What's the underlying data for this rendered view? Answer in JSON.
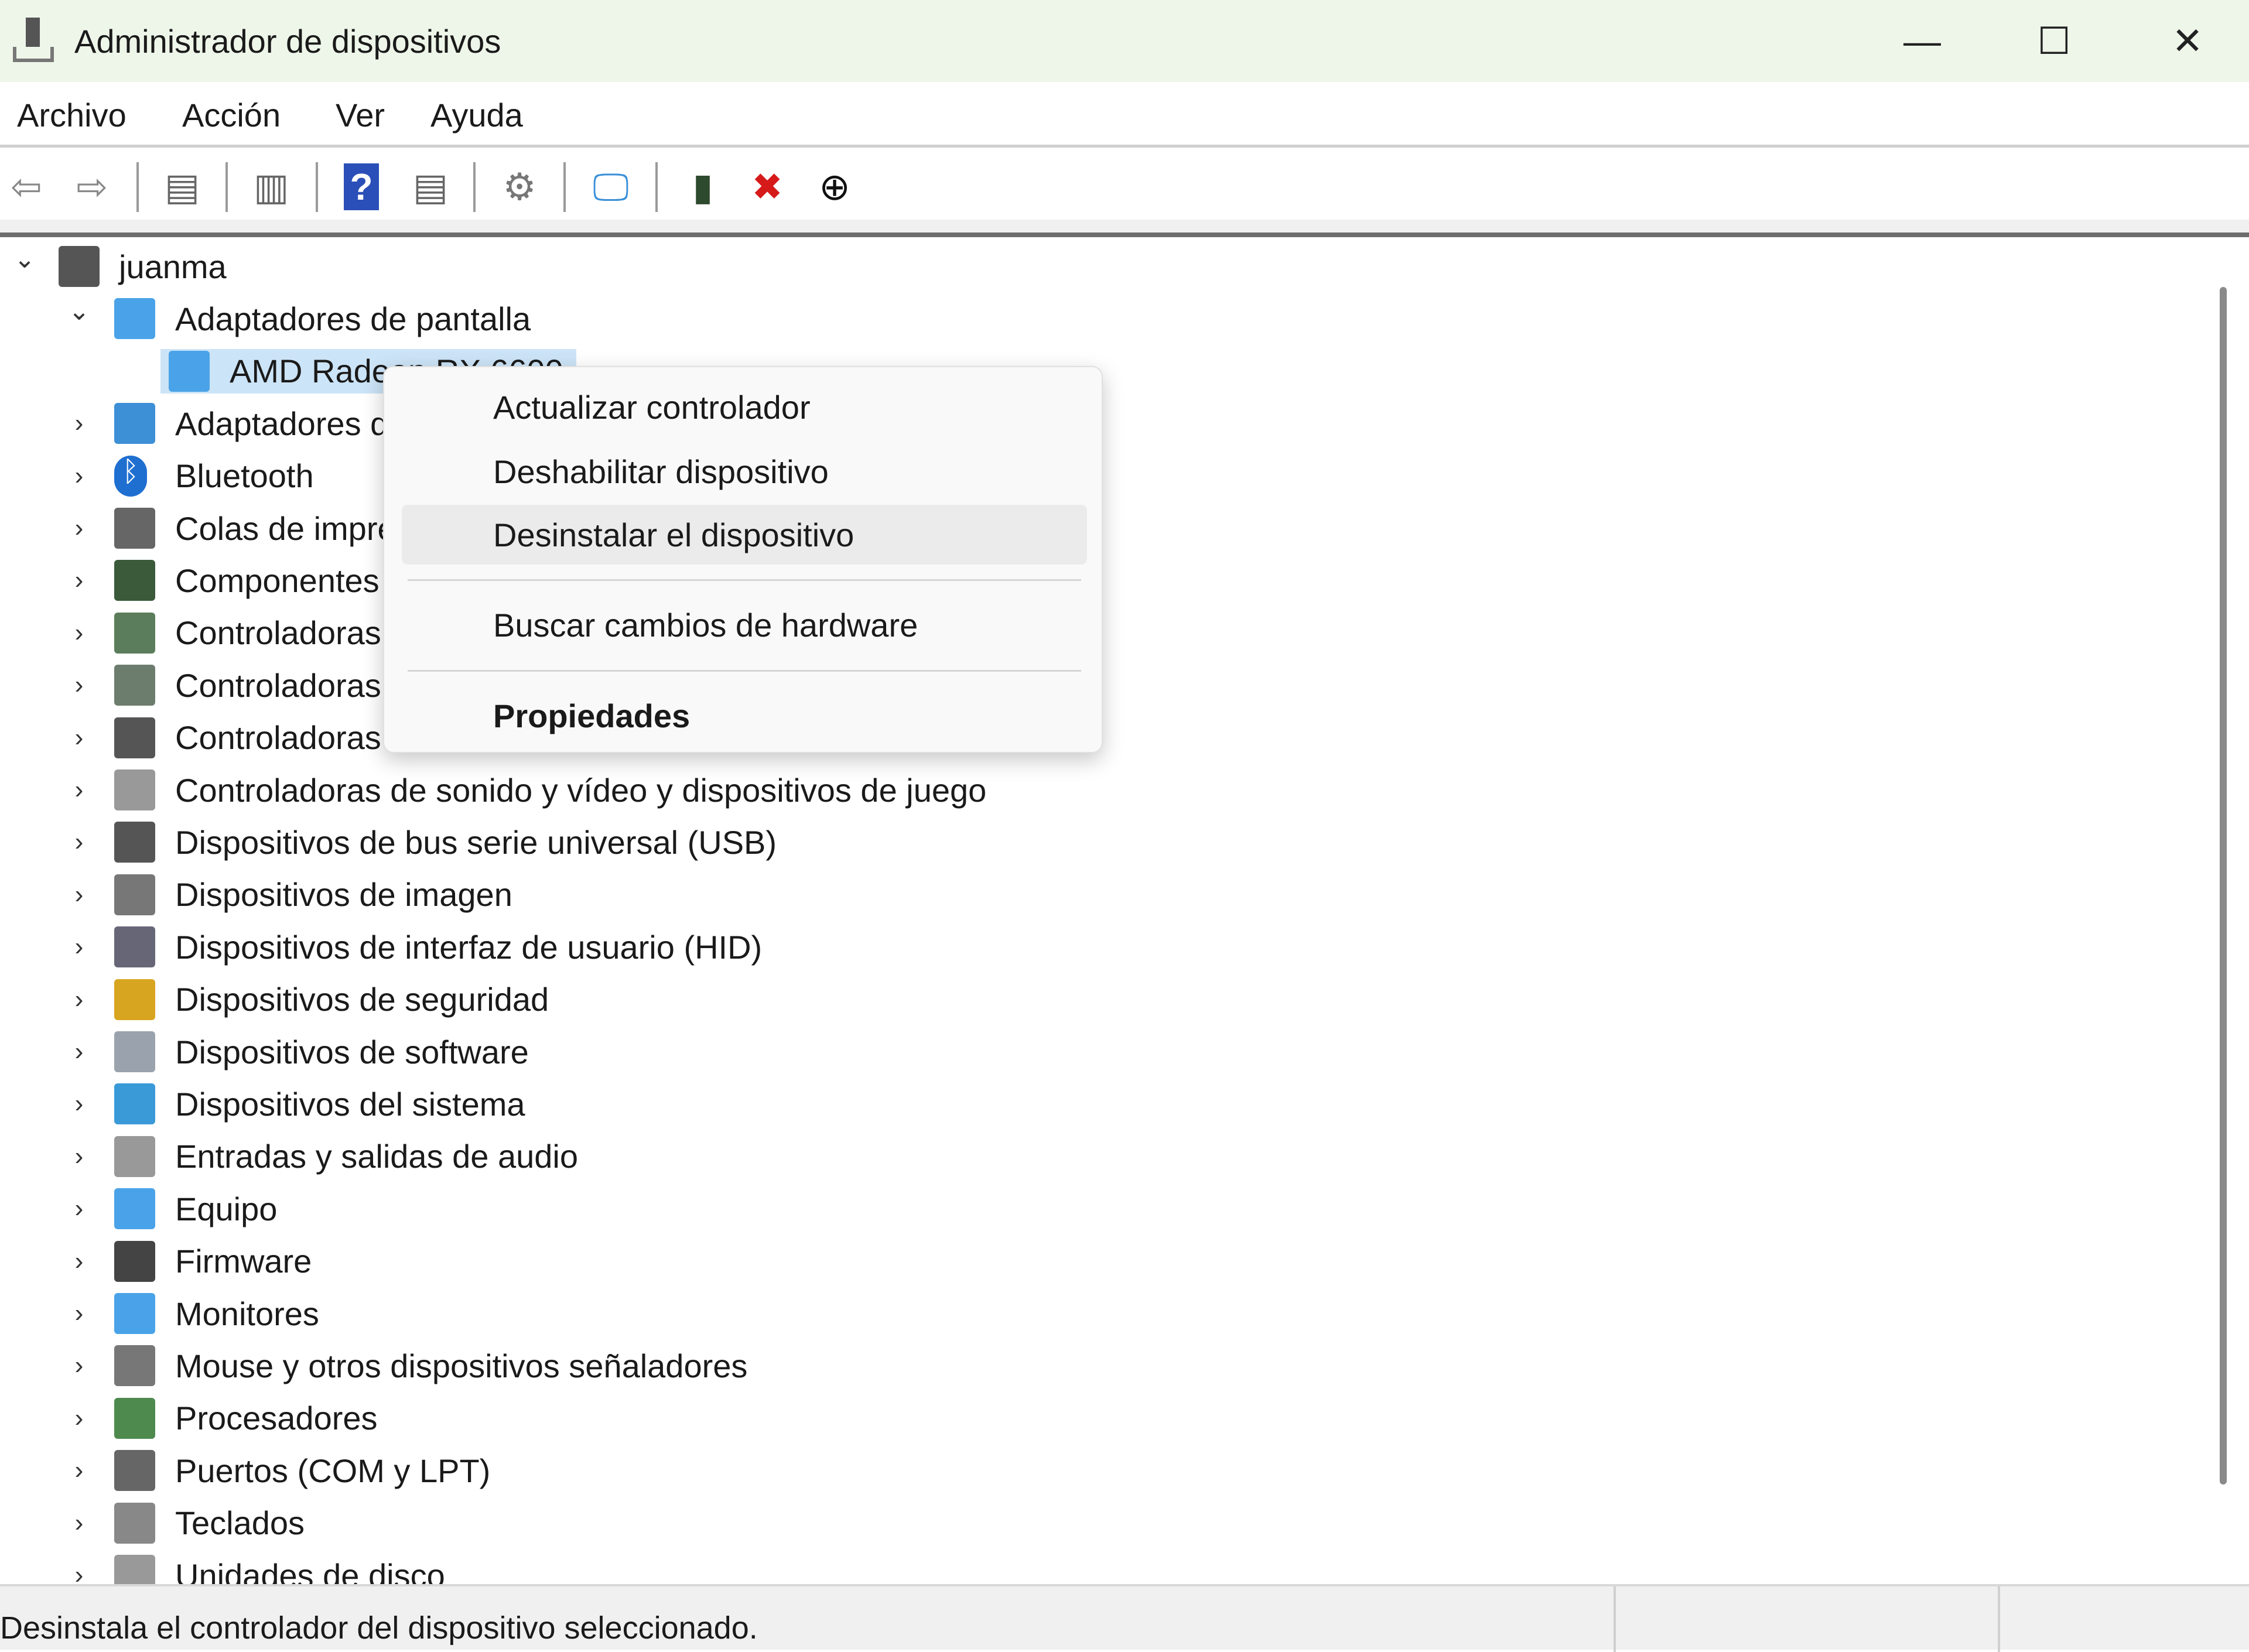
{
  "window": {
    "title": "Administrador de dispositivos",
    "minimize": "—",
    "maximize": "☐",
    "close": "✕"
  },
  "menu": [
    "Archivo",
    "Acción",
    "Ver",
    "Ayuda"
  ],
  "toolbar": [
    {
      "icon": "back-arrow-icon",
      "glyph": "⇦",
      "color": "#888"
    },
    {
      "icon": "forward-arrow-icon",
      "glyph": "⇨",
      "color": "#888"
    },
    {
      "icon": "show-hide-console-tree-icon",
      "glyph": "▤",
      "color": "#666"
    },
    {
      "icon": "properties-icon",
      "glyph": "▥",
      "color": "#666"
    },
    {
      "icon": "help-icon",
      "glyph": "?",
      "color": "#fff",
      "bg": "#2b4fb8"
    },
    {
      "icon": "show-action-pane-icon",
      "glyph": "▤",
      "color": "#666"
    },
    {
      "icon": "update-driver-icon",
      "glyph": "⚙",
      "color": "#777"
    },
    {
      "icon": "scan-hardware-icon",
      "glyph": "🖵",
      "color": "#3a8fd8"
    },
    {
      "icon": "enable-device-icon",
      "glyph": "▮",
      "color": "#2e4a2e"
    },
    {
      "icon": "uninstall-device-icon",
      "glyph": "✖",
      "color": "#d61a1a"
    },
    {
      "icon": "disable-device-icon",
      "glyph": "⊕",
      "color": "#111"
    }
  ],
  "tree": {
    "root": "juanma",
    "items": [
      {
        "label": "Adaptadores de pantalla",
        "level": 1,
        "expanded": true,
        "icon": "display-adapter-icon",
        "color": "#4aa3e8"
      },
      {
        "label": "AMD Radeon RX 6600",
        "level": 2,
        "selected": true,
        "icon": "display-adapter-icon",
        "color": "#4aa3e8"
      },
      {
        "label": "Adaptadores de red",
        "level": 1,
        "icon": "network-adapter-icon",
        "color": "#3d8fd6"
      },
      {
        "label": "Bluetooth",
        "level": 1,
        "icon": "bluetooth-icon",
        "color": "#1f6fd1"
      },
      {
        "label": "Colas de impresión",
        "level": 1,
        "icon": "printer-icon",
        "color": "#666"
      },
      {
        "label": "Componentes de software",
        "level": 1,
        "icon": "software-component-icon",
        "color": "#3a5a3a"
      },
      {
        "label": "Controladoras ATA/ATAPI IDE",
        "level": 1,
        "icon": "ide-controller-icon",
        "color": "#5b7d5b"
      },
      {
        "label": "Controladoras de almacenamiento",
        "level": 1,
        "icon": "storage-controller-icon",
        "color": "#6d7d6d"
      },
      {
        "label": "Controladoras de bus serie universal",
        "level": 1,
        "icon": "usb-controller-icon",
        "color": "#555"
      },
      {
        "label": "Controladoras de sonido y vídeo y dispositivos de juego",
        "level": 1,
        "icon": "speaker-icon",
        "color": "#999"
      },
      {
        "label": "Dispositivos de bus serie universal (USB)",
        "level": 1,
        "icon": "usb-device-icon",
        "color": "#555"
      },
      {
        "label": "Dispositivos de imagen",
        "level": 1,
        "icon": "camera-icon",
        "color": "#777"
      },
      {
        "label": "Dispositivos de interfaz de usuario (HID)",
        "level": 1,
        "icon": "hid-icon",
        "color": "#667"
      },
      {
        "label": "Dispositivos de seguridad",
        "level": 1,
        "icon": "security-key-icon",
        "color": "#d8a520"
      },
      {
        "label": "Dispositivos de software",
        "level": 1,
        "icon": "software-device-icon",
        "color": "#9aa3ad"
      },
      {
        "label": "Dispositivos del sistema",
        "level": 1,
        "icon": "system-folder-icon",
        "color": "#3a9ad8"
      },
      {
        "label": "Entradas y salidas de audio",
        "level": 1,
        "icon": "speaker-icon",
        "color": "#999"
      },
      {
        "label": "Equipo",
        "level": 1,
        "icon": "computer-icon",
        "color": "#4aa3e8"
      },
      {
        "label": "Firmware",
        "level": 1,
        "icon": "firmware-chip-icon",
        "color": "#444"
      },
      {
        "label": "Monitores",
        "level": 1,
        "icon": "monitor-icon",
        "color": "#4aa3e8"
      },
      {
        "label": "Mouse y otros dispositivos señaladores",
        "level": 1,
        "icon": "mouse-icon",
        "color": "#777"
      },
      {
        "label": "Procesadores",
        "level": 1,
        "icon": "processor-icon",
        "color": "#4e8a4e"
      },
      {
        "label": "Puertos (COM y LPT)",
        "level": 1,
        "icon": "port-icon",
        "color": "#666"
      },
      {
        "label": "Teclados",
        "level": 1,
        "icon": "keyboard-icon",
        "color": "#888"
      },
      {
        "label": "Unidades de disco",
        "level": 1,
        "icon": "disk-drive-icon",
        "color": "#999"
      }
    ]
  },
  "context_menu": {
    "update_driver": "Actualizar controlador",
    "disable_device": "Deshabilitar dispositivo",
    "uninstall_device": "Desinstalar el dispositivo",
    "scan_hardware": "Buscar cambios de hardware",
    "properties": "Propiedades"
  },
  "status": {
    "text": "Desinstala el controlador del dispositivo seleccionado."
  }
}
